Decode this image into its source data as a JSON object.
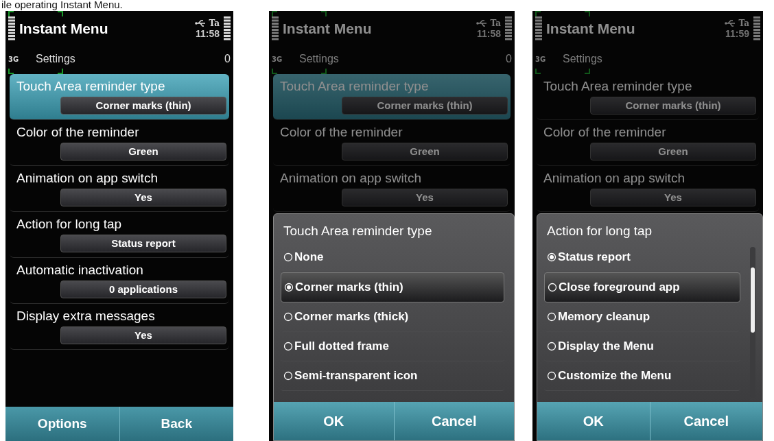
{
  "caption": "ile operating Instant Menu.",
  "screens": [
    {
      "app_title": "Instant Menu",
      "status_text": "Ta",
      "time": "11:58",
      "network": "3G",
      "subtitle": "Settings",
      "counter": "0",
      "corner_marks": true,
      "settings": [
        {
          "label": "Touch Area reminder type",
          "value": "Corner marks (thin)",
          "selected": true
        },
        {
          "label": "Color of the reminder",
          "value": "Green",
          "selected": false
        },
        {
          "label": "Animation on app switch",
          "value": "Yes",
          "selected": false
        },
        {
          "label": "Action for long tap",
          "value": "Status report",
          "selected": false
        },
        {
          "label": "Automatic inactivation",
          "value": "0 applications",
          "selected": false
        },
        {
          "label": "Display extra messages",
          "value": "Yes",
          "selected": false
        }
      ],
      "softkeys": [
        "Options",
        "Back"
      ]
    },
    {
      "app_title": "Instant Menu",
      "status_text": "Ta",
      "time": "11:58",
      "network": "3G",
      "subtitle": "Settings",
      "counter": "0",
      "corner_marks": true,
      "settings": [
        {
          "label": "Touch Area reminder type",
          "value": "Corner marks (thin)",
          "selected": true
        },
        {
          "label": "Color of the reminder",
          "value": "Green",
          "selected": false
        },
        {
          "label": "Animation on app switch",
          "value": "Yes",
          "selected": false
        }
      ],
      "dialog": {
        "title": "Touch Area reminder type",
        "scrollable": false,
        "options": [
          {
            "label": "None",
            "checked": false,
            "highlighted": false
          },
          {
            "label": "Corner marks (thin)",
            "checked": true,
            "highlighted": true
          },
          {
            "label": "Corner marks (thick)",
            "checked": false,
            "highlighted": false
          },
          {
            "label": "Full dotted frame",
            "checked": false,
            "highlighted": false
          },
          {
            "label": "Semi-transparent icon",
            "checked": false,
            "highlighted": false
          }
        ],
        "buttons": [
          "OK",
          "Cancel"
        ]
      }
    },
    {
      "app_title": "Instant Menu",
      "status_text": "Ta",
      "time": "11:59",
      "network": "3G",
      "subtitle": "Settings",
      "corner_marks": true,
      "settings": [
        {
          "label": "Touch Area reminder type",
          "value": "Corner marks (thin)",
          "selected": false
        },
        {
          "label": "Color of the reminder",
          "value": "Green",
          "selected": false
        },
        {
          "label": "Animation on app switch",
          "value": "Yes",
          "selected": false
        }
      ],
      "dialog": {
        "title": "Action for long tap",
        "scrollable": true,
        "options": [
          {
            "label": "Status report",
            "checked": true,
            "highlighted": false
          },
          {
            "label": "Close foreground app",
            "checked": false,
            "highlighted": true
          },
          {
            "label": "Memory cleanup",
            "checked": false,
            "highlighted": false
          },
          {
            "label": "Display the Menu",
            "checked": false,
            "highlighted": false
          },
          {
            "label": "Customize the Menu",
            "checked": false,
            "highlighted": false
          }
        ],
        "buttons": [
          "OK",
          "Cancel"
        ]
      }
    }
  ]
}
